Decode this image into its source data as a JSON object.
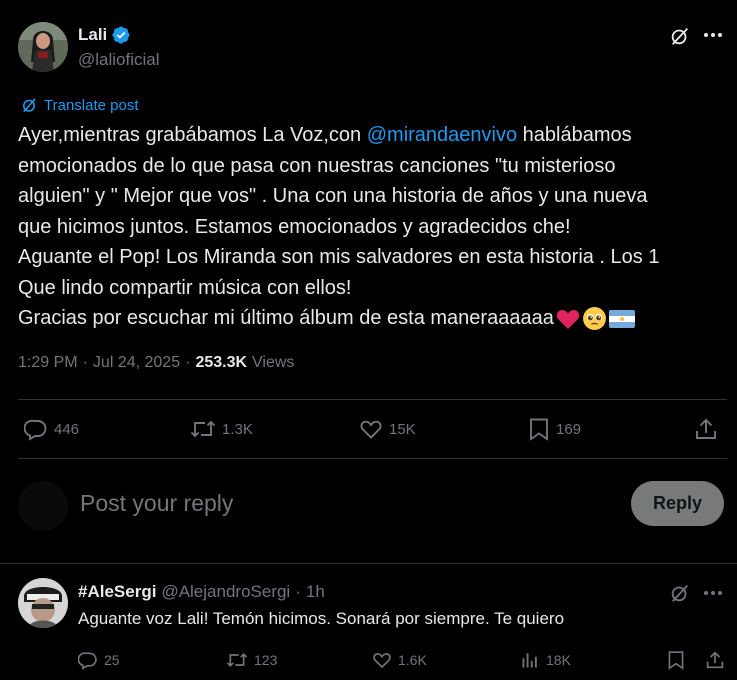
{
  "tweet": {
    "author_name": "Lali",
    "author_handle": "@lalioficial",
    "translate_label": "Translate post",
    "text_lines": [
      {
        "pre": "Ayer,mientras grabábamos La Voz,con ",
        "mention": "@mirandaenvivo",
        "post": " hablábamos"
      },
      {
        "text": "emocionados de lo que pasa con nuestras canciones \"tu misterioso"
      },
      {
        "text": "alguien\" y \" Mejor que vos\" . Una con una historia de años y una nueva"
      },
      {
        "text": "que hicimos juntos. Estamos emocionados y agradecidos che!"
      },
      {
        "text": "Aguante el Pop! Los Miranda son mis salvadores en esta historia . Los 1"
      },
      {
        "text": "Que lindo compartir música con ellos!"
      },
      {
        "text": "Gracias por escuchar mi último álbum de esta maneraaaaaa"
      }
    ],
    "time": "1:29 PM",
    "date": "Jul 24, 2025",
    "views_count": "253.3K",
    "views_label": "Views",
    "replies": "446",
    "reposts": "1.3K",
    "likes": "15K",
    "bookmarks": "169"
  },
  "composer": {
    "placeholder": "Post your reply",
    "reply_label": "Reply"
  },
  "reply": {
    "author_name": "#AleSergi",
    "author_handle": "@AlejandroSergi",
    "separator": "·",
    "time": "1h",
    "text": "Aguante voz Lali! Temón hicimos. Sonará por siempre. Te quiero",
    "replies": "25",
    "reposts": "123",
    "likes": "1.6K",
    "views": "18K"
  },
  "colors": {
    "background": "#000000",
    "text": "#e7e9ea",
    "muted": "#71767b",
    "link": "#1d9bf0",
    "verified": "#1d9bf0",
    "heart": "#e0245e",
    "divider": "#2f3336"
  },
  "icons": [
    "verified-badge-icon",
    "grok-icon",
    "more-icon",
    "translate-icon",
    "reply-icon",
    "repost-icon",
    "like-icon",
    "bookmark-icon",
    "share-icon",
    "views-icon",
    "red-heart-emoji",
    "pleading-face-emoji",
    "argentina-flag-emoji"
  ]
}
